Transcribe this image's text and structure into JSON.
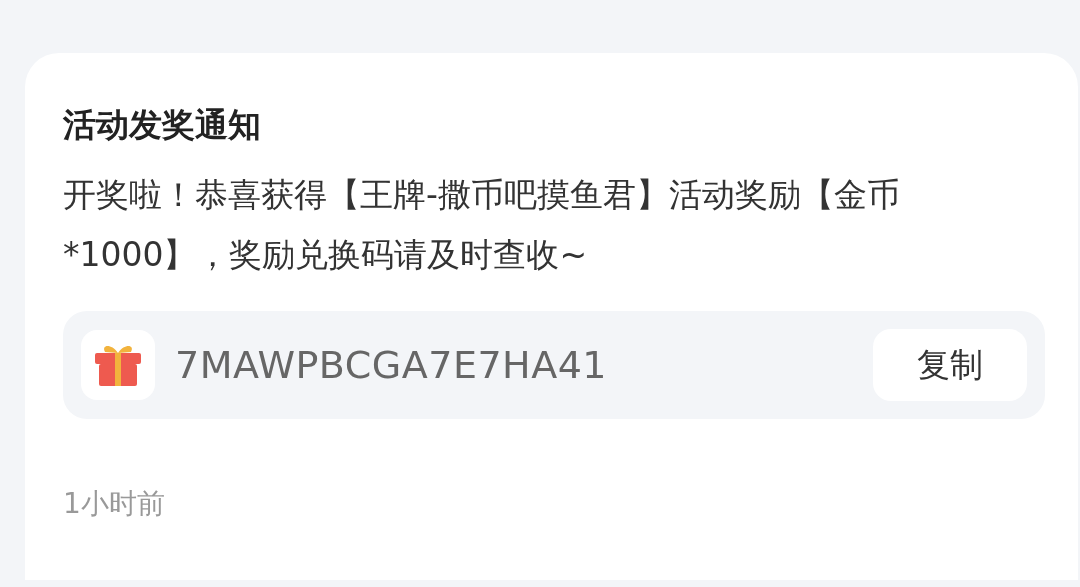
{
  "notification": {
    "title": "活动发奖通知",
    "message": "开奖啦！恭喜获得【王牌-撒币吧摸鱼君】活动奖励【金币*1000】，奖励兑换码请及时查收~",
    "code": "7MAWPBCGA7E7HA41",
    "copy_button": "复制",
    "time": "1小时前"
  }
}
